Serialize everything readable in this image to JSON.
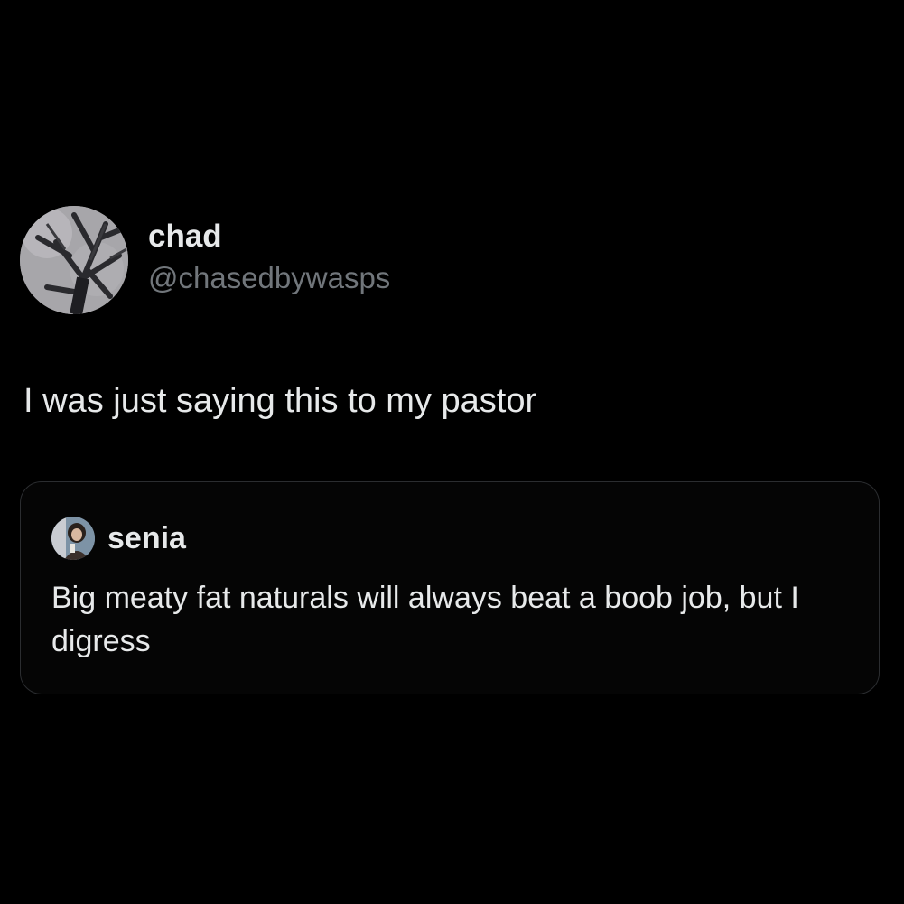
{
  "tweet": {
    "author": {
      "display_name": "chad",
      "handle": "@chasedbywasps",
      "avatar_icon": "tree-branches-avatar"
    },
    "text": "I was just saying this to my pastor"
  },
  "quoted_tweet": {
    "author": {
      "display_name": "senia",
      "avatar_icon": "person-photo-avatar"
    },
    "text": "Big meaty fat naturals will always beat a boob job, but I digress"
  },
  "colors": {
    "background": "#000000",
    "primary_text": "#e7e9ea",
    "secondary_text": "#71767b",
    "card_border": "#2b2d30"
  }
}
